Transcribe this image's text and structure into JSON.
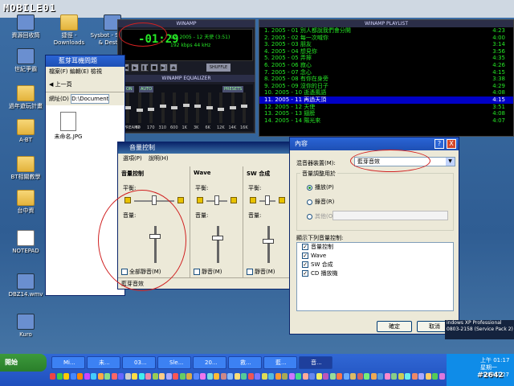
{
  "topbar": {
    "logo": "MOBILE01"
  },
  "desktop_icons": [
    {
      "label": "資源回收筒",
      "kind": "app"
    },
    {
      "label": "捷徑 - Downloads",
      "kind": "folder"
    },
    {
      "label": "Sysbot - Search & Destroy",
      "kind": "app"
    },
    {
      "label": "世紀爭霸",
      "kind": "app"
    },
    {
      "label": "過年遊玩計畫",
      "kind": "folder"
    },
    {
      "label": "A-BT",
      "kind": "folder"
    },
    {
      "label": "BT相關教學",
      "kind": "folder"
    },
    {
      "label": "台中資",
      "kind": "folder"
    },
    {
      "label": "NOTEPAD",
      "kind": "doc"
    },
    {
      "label": "DBZ14.wmv",
      "kind": "app"
    },
    {
      "label": "Kuro",
      "kind": "app"
    }
  ],
  "winamp": {
    "title": "WINAMP",
    "time": "01:29",
    "song": "12. 2005 - 12 天使 (3:51)",
    "kbps": "192",
    "khz": "44",
    "kbps_unit": "kbps",
    "khz_unit": "kHz",
    "controls": [
      "|◀",
      "▶",
      "❚❚",
      "■",
      "▶|",
      "⏏"
    ],
    "shuffle": "SHUFFLE",
    "eq_title": "WINAMP EQUALIZER",
    "eq_on": "ON",
    "eq_auto": "AUTO",
    "eq_presets": "PRESETS",
    "eq_bands": [
      "PREAMP",
      "60",
      "170",
      "310",
      "600",
      "1K",
      "3K",
      "6K",
      "12K",
      "14K",
      "16K"
    ],
    "eq_levels": [
      0.5,
      0.4,
      0.45,
      0.55,
      0.5,
      0.6,
      0.55,
      0.5,
      0.45,
      0.5,
      0.55
    ]
  },
  "playlist": {
    "title": "WINAMP PLAYLIST",
    "items": [
      {
        "label": "1. 2005 - 01 別人都說我們會分開",
        "time": "4:23"
      },
      {
        "label": "2. 2005 - 02 每一次喊你",
        "time": "4:00"
      },
      {
        "label": "3. 2005 - 03 朋友",
        "time": "3:14"
      },
      {
        "label": "4. 2005 - 04 想見你",
        "time": "3:56"
      },
      {
        "label": "5. 2005 - 05 弄擰",
        "time": "4:35"
      },
      {
        "label": "6. 2005 - 06 寂心",
        "time": "4:26"
      },
      {
        "label": "7. 2005 - 07 念心",
        "time": "4:15"
      },
      {
        "label": "8. 2005 - 08 有你在身旁",
        "time": "3:38"
      },
      {
        "label": "9. 2005 - 09 沒你的日子",
        "time": "4:29"
      },
      {
        "label": "10. 2005 - 10 逝憑風語",
        "time": "4:08"
      },
      {
        "label": "11. 2005 - 11 再過天頂",
        "time": "4:15",
        "selected": true
      },
      {
        "label": "12. 2005 - 12 天使",
        "time": "3:51"
      },
      {
        "label": "13. 2005 - 13 翅膀",
        "time": "4:08"
      },
      {
        "label": "14. 2005 - 14 陽光來",
        "time": "4:07"
      }
    ]
  },
  "explorer": {
    "title": "藍芽耳機問題",
    "menu": "檔案(F)  編輯(E)  檢視",
    "back": "上一頁",
    "address_label": "網址(D)",
    "address": "D:\\Documents a",
    "file": "未命名.JPG"
  },
  "volume": {
    "title": "音量控制",
    "menu": [
      "選項(P)",
      "說明(H)"
    ],
    "columns": [
      {
        "name": "音量控制",
        "mute": "全部靜音(M)",
        "level": 0.75
      },
      {
        "name": "Wave",
        "mute": "靜音(M)",
        "level": 0.7
      },
      {
        "name": "SW 合成",
        "mute": "靜音(M)",
        "level": 0.6
      }
    ],
    "balance_label": "平衡:",
    "volume_label": "音量:",
    "status": "藍芽音效"
  },
  "dialog": {
    "title": "內容",
    "help": "?",
    "close": "X",
    "mixer_label": "混音器裝置(M):",
    "mixer_value": "藍芽音效",
    "group_label": "音量調整用於",
    "radios": [
      {
        "label": "播放(P)",
        "checked": true
      },
      {
        "label": "錄音(R)",
        "checked": false
      },
      {
        "label": "其他(O)",
        "checked": false
      }
    ],
    "list_label": "顯示下列音量控制:",
    "items": [
      "音量控制",
      "Wave",
      "SW 合成",
      "CD 播放機"
    ],
    "ok": "確定",
    "cancel": "取消"
  },
  "winxp": {
    "line1": "indows XP Professional",
    "line2": "0803-2158 (Service Pack 2)"
  },
  "taskbar": {
    "start": "開始",
    "buttons": [
      "Mi...",
      "未...",
      "03...",
      "Sle...",
      "20...",
      "救...",
      "藍...",
      "音..."
    ],
    "active_index": 7,
    "clock_time": "上午 01:17",
    "clock_day": "星期一",
    "clock_date": "2006/2/27"
  },
  "watermark": "#2642"
}
